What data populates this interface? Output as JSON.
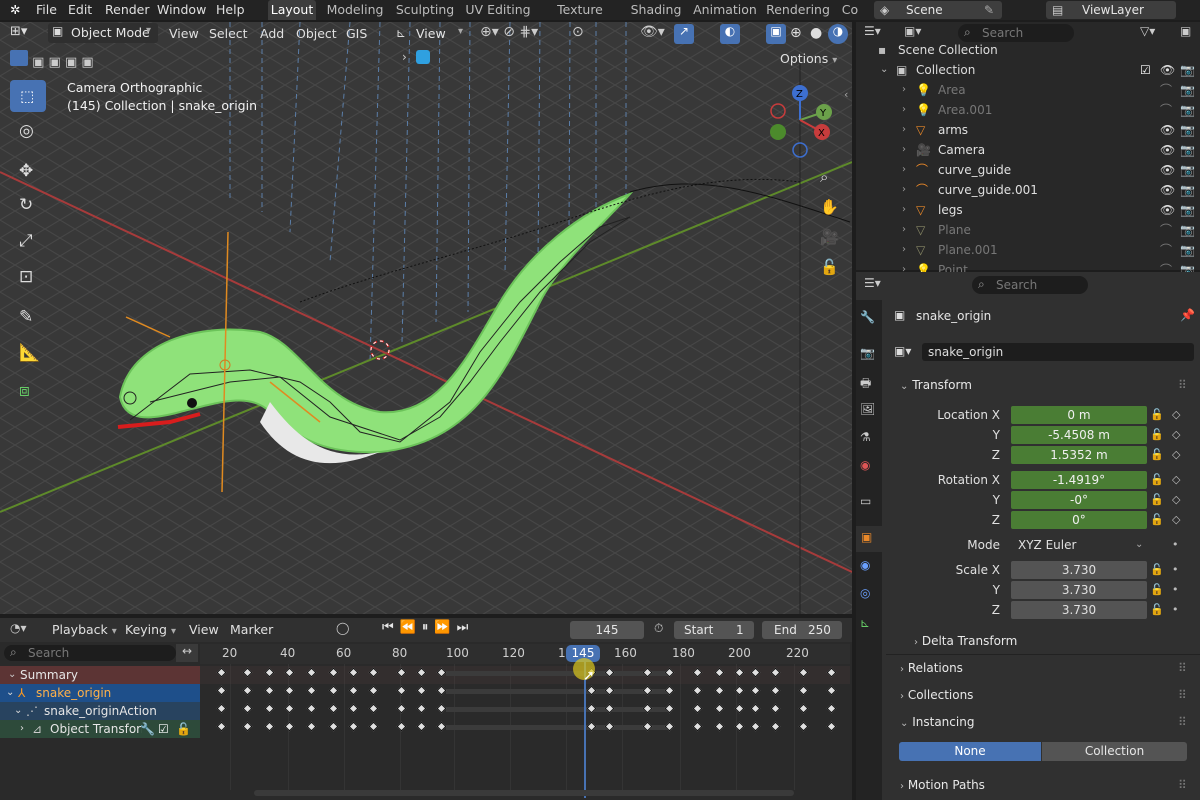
{
  "topbar": {
    "menus": [
      "File",
      "Edit",
      "Render",
      "Window",
      "Help"
    ],
    "workspaces": [
      "Layout",
      "Modeling",
      "Sculpting",
      "UV Editing",
      "Texture Paint",
      "Shading",
      "Animation",
      "Rendering",
      "Co"
    ],
    "active_workspace": "Layout",
    "scene": "Scene",
    "view_layer": "ViewLayer"
  },
  "viewport": {
    "mode": "Object Mode",
    "menus": [
      "View",
      "Select",
      "Add",
      "Object",
      "GIS"
    ],
    "transform_orientation": "View",
    "options": "Options",
    "overlay_title": "Camera Orthographic",
    "overlay_subtitle": "(145) Collection | snake_origin",
    "gizmo_axes": [
      "Z",
      "Y",
      "X"
    ]
  },
  "outliner": {
    "search_placeholder": "Search",
    "root": "Scene Collection",
    "collection": "Collection",
    "items": [
      {
        "name": "Area",
        "dim": true
      },
      {
        "name": "Area.001",
        "dim": true
      },
      {
        "name": "arms",
        "dim": false
      },
      {
        "name": "Camera",
        "dim": false
      },
      {
        "name": "curve_guide",
        "dim": false
      },
      {
        "name": "curve_guide.001",
        "dim": false
      },
      {
        "name": "legs",
        "dim": false
      },
      {
        "name": "Plane",
        "dim": true
      },
      {
        "name": "Plane.001",
        "dim": true
      },
      {
        "name": "Point",
        "dim": true
      }
    ]
  },
  "properties": {
    "search_placeholder": "Search",
    "object_name": "snake_origin",
    "data_name": "snake_origin",
    "transform_label": "Transform",
    "location": {
      "label_x": "Location X",
      "label_y": "Y",
      "label_z": "Z",
      "x": "0 m",
      "y": "-5.4508 m",
      "z": "1.5352 m"
    },
    "rotation": {
      "label_x": "Rotation X",
      "label_y": "Y",
      "label_z": "Z",
      "x": "-1.4919°",
      "y": "-0°",
      "z": "0°"
    },
    "mode_label": "Mode",
    "mode_value": "XYZ Euler",
    "scale": {
      "label_x": "Scale X",
      "label_y": "Y",
      "label_z": "Z",
      "x": "3.730",
      "y": "3.730",
      "z": "3.730"
    },
    "delta": "Delta Transform",
    "relations": "Relations",
    "collections": "Collections",
    "instancing": "Instancing",
    "inst_none": "None",
    "inst_collection": "Collection",
    "motion_paths": "Motion Paths"
  },
  "timeline": {
    "menus": [
      "Playback",
      "Keying",
      "View",
      "Marker"
    ],
    "current_frame": "145",
    "start_label": "Start",
    "start": "1",
    "end_label": "End",
    "end": "250",
    "search_placeholder": "Search",
    "ruler": [
      "20",
      "40",
      "60",
      "80",
      "100",
      "120",
      "14",
      "160",
      "180",
      "200",
      "220"
    ],
    "playhead": "145",
    "channels": [
      "Summary",
      "snake_origin",
      "snake_originAction",
      "Object Transforn"
    ]
  }
}
